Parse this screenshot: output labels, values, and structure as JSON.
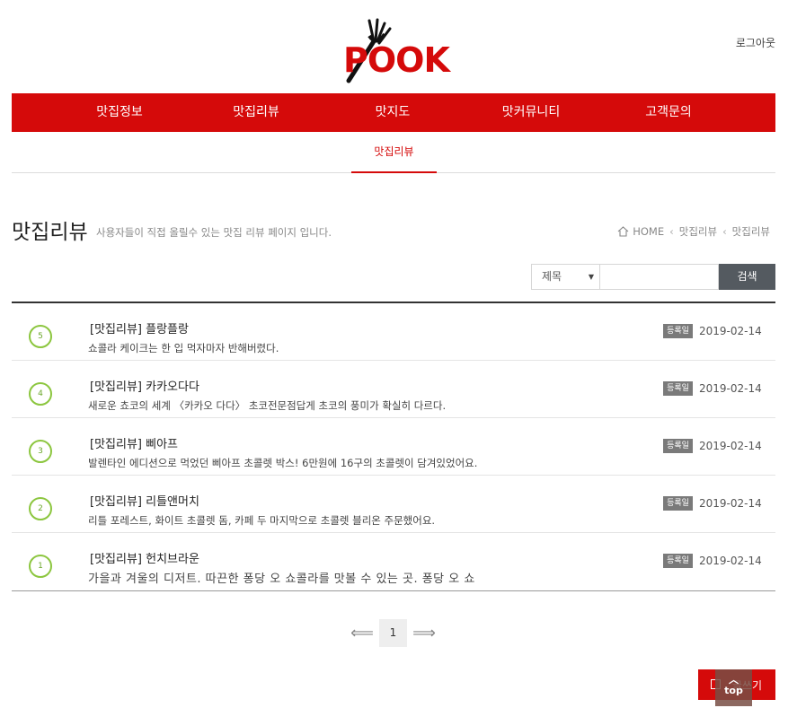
{
  "header": {
    "logo_text": "POOK",
    "logout_label": "로그아웃"
  },
  "gnb": {
    "items": [
      {
        "label": "맛집정보"
      },
      {
        "label": "맛집리뷰"
      },
      {
        "label": "맛지도"
      },
      {
        "label": "맛커뮤니티"
      },
      {
        "label": "고객문의"
      }
    ]
  },
  "subnav": {
    "active_label": "맛집리뷰"
  },
  "page": {
    "title": "맛집리뷰",
    "description": "사용자들이 직접 올릴수 있는 맛집 리뷰 페이지 입니다.",
    "breadcrumb": {
      "home": "HOME",
      "level1": "맛집리뷰",
      "level2": "맛집리뷰"
    }
  },
  "search": {
    "select_value": "제목",
    "input_value": "",
    "button_label": "검색"
  },
  "list": {
    "badge_label": "등록일",
    "rows": [
      {
        "num": "5",
        "title": "[맛집리뷰] 플랑플랑",
        "desc": "쇼콜라 케이크는 한 입 먹자마자 반해버렸다.",
        "date": "2019-02-14"
      },
      {
        "num": "4",
        "title": "[맛집리뷰] 카카오다다",
        "desc": "새로운 쵸코의 세계 〈카카오 다다〉 초코전문점답게 초코의 풍미가 확실히 다르다.",
        "date": "2019-02-14"
      },
      {
        "num": "3",
        "title": "[맛집리뷰] 삐아프",
        "desc": " 발렌타인 에디션으로 먹었던 삐아프 초콜렛 박스! 6만원에 16구의 초콜렛이 담겨있었어요.",
        "date": "2019-02-14"
      },
      {
        "num": "2",
        "title": "[맛집리뷰] 리틀앤머치",
        "desc": "리틀 포레스트, 화이트 초콜렛 돔, 카페 두 마지막으로 초콜렛 블리온 주문했어요.",
        "date": "2019-02-14"
      },
      {
        "num": "1",
        "title": "[맛집리뷰] 헌치브라운",
        "desc": "가을과 겨울의 디저트. 따끈한 퐁당 오 쇼콜라를 맛볼 수 있는 곳. 퐁당 오 쇼",
        "date": "2019-02-14"
      }
    ]
  },
  "pager": {
    "current": "1"
  },
  "actions": {
    "write_label": "글쓰기",
    "top_label": "top"
  },
  "colors": {
    "brand_red": "#d50a0a",
    "number_green": "#8cc63f",
    "search_button": "#545a60"
  }
}
